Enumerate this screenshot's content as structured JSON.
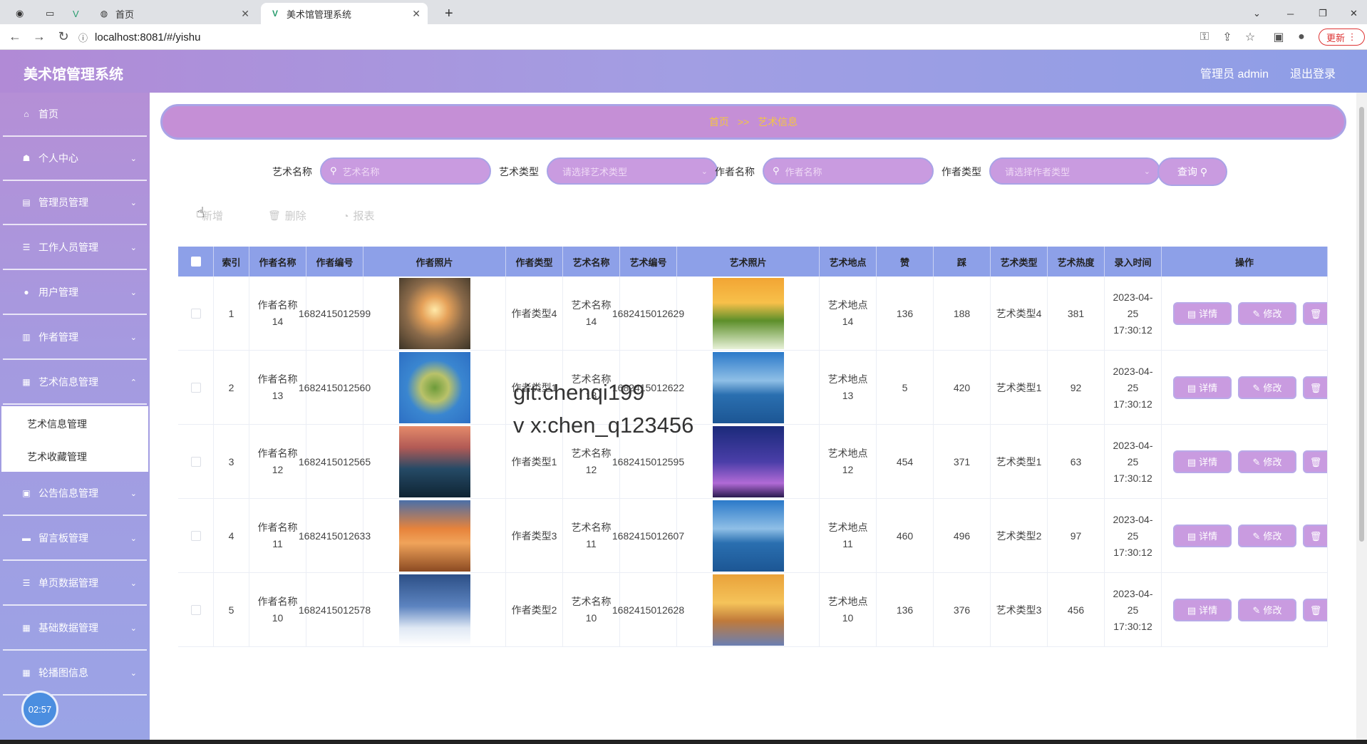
{
  "browser": {
    "tabs": [
      {
        "label": "首页",
        "icon": "globe-icon"
      },
      {
        "label": "美术馆管理系统",
        "icon": "vue-icon"
      }
    ],
    "url": "localhost:8081/#/yishu",
    "update_label": "更新"
  },
  "header": {
    "title": "美术馆管理系统",
    "admin": "管理员 admin",
    "logout": "退出登录"
  },
  "sidebar": {
    "items": [
      {
        "label": "首页",
        "icon": "home-icon"
      },
      {
        "label": "个人中心",
        "icon": "user-icon"
      },
      {
        "label": "管理员管理",
        "icon": "admin-icon"
      },
      {
        "label": "工作人员管理",
        "icon": "staff-icon"
      },
      {
        "label": "用户管理",
        "icon": "users-icon"
      },
      {
        "label": "作者管理",
        "icon": "author-icon"
      },
      {
        "label": "艺术信息管理",
        "icon": "art-icon"
      },
      {
        "label": "公告信息管理",
        "icon": "notice-icon"
      },
      {
        "label": "留言板管理",
        "icon": "message-icon"
      },
      {
        "label": "单页数据管理",
        "icon": "page-icon"
      },
      {
        "label": "基础数据管理",
        "icon": "data-icon"
      },
      {
        "label": "轮播图信息",
        "icon": "carousel-icon"
      }
    ],
    "submenu": [
      "艺术信息管理",
      "艺术收藏管理"
    ],
    "time": "02:57"
  },
  "breadcrumb": {
    "home": "首页",
    "sep": ">>",
    "current": "艺术信息"
  },
  "filters": {
    "art_name_label": "艺术名称",
    "art_name_placeholder": "艺术名称",
    "art_type_label": "艺术类型",
    "art_type_placeholder": "请选择艺术类型",
    "author_name_label": "作者名称",
    "author_name_placeholder": "作者名称",
    "author_type_label": "作者类型",
    "author_type_placeholder": "请选择作者类型",
    "search_label": "查询"
  },
  "actions": {
    "add": "新增",
    "delete": "删除",
    "report": "报表"
  },
  "table": {
    "headers": [
      "索引",
      "作者名称",
      "作者编号",
      "作者照片",
      "作者类型",
      "艺术名称",
      "艺术编号",
      "艺术照片",
      "艺术地点",
      "赞",
      "踩",
      "艺术类型",
      "艺术热度",
      "录入时间",
      "操作"
    ],
    "detail_label": "详情",
    "edit_label": "修改",
    "rows": [
      {
        "index": "1",
        "author_name": "作者名称14",
        "author_no": "1682415012599",
        "author_type": "作者类型4",
        "art_name": "艺术名称14",
        "art_no": "1682415012629",
        "location": "艺术地点14",
        "like": "136",
        "dislike": "188",
        "art_type": "艺术类型4",
        "heat": "381",
        "time": "2023-04-25 17:30:12",
        "author_photo": "sunset-field",
        "art_photo": "flower-field"
      },
      {
        "index": "2",
        "author_name": "作者名称13",
        "author_no": "1682415012560",
        "author_type": "作者类型1",
        "art_name": "艺术名称13",
        "art_no": "1682415012622",
        "location": "艺术地点13",
        "like": "5",
        "dislike": "420",
        "art_type": "艺术类型1",
        "heat": "92",
        "time": "2023-04-25 17:30:12",
        "author_photo": "tiny-planet",
        "art_photo": "sea-sky"
      },
      {
        "index": "3",
        "author_name": "作者名称12",
        "author_no": "1682415012565",
        "author_type": "作者类型1",
        "art_name": "艺术名称12",
        "art_no": "1682415012595",
        "location": "艺术地点12",
        "like": "454",
        "dislike": "371",
        "art_type": "艺术类型1",
        "heat": "63",
        "time": "2023-04-25 17:30:12",
        "author_photo": "dusk-lake",
        "art_photo": "eiffel-tower"
      },
      {
        "index": "4",
        "author_name": "作者名称11",
        "author_no": "1682415012633",
        "author_type": "作者类型3",
        "art_name": "艺术名称11",
        "art_no": "1682415012607",
        "location": "艺术地点11",
        "like": "460",
        "dislike": "496",
        "art_type": "艺术类型2",
        "heat": "97",
        "time": "2023-04-25 17:30:12",
        "author_photo": "orange-rock",
        "art_photo": "sea-sky"
      },
      {
        "index": "5",
        "author_name": "作者名称10",
        "author_no": "1682415012578",
        "author_type": "作者类型2",
        "art_name": "艺术名称10",
        "art_no": "1682415012628",
        "location": "艺术地点10",
        "like": "136",
        "dislike": "376",
        "art_type": "艺术类型3",
        "heat": "456",
        "time": "2023-04-25 17:30:12",
        "author_photo": "snow-cabin",
        "art_photo": "sunset-beach"
      }
    ]
  },
  "watermark": [
    "git:chenqi199",
    "v x:chen_q123456"
  ]
}
